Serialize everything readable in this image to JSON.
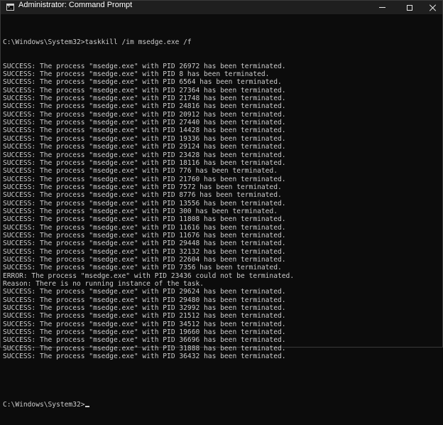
{
  "window": {
    "title": "Administrator: Command Prompt",
    "icon": "cmd-icon"
  },
  "terminal": {
    "command_line": "C:\\Windows\\System32>taskkill /im msedge.exe /f",
    "output_lines": [
      "SUCCESS: The process \"msedge.exe\" with PID 26972 has been terminated.",
      "SUCCESS: The process \"msedge.exe\" with PID 8 has been terminated.",
      "SUCCESS: The process \"msedge.exe\" with PID 6564 has been terminated.",
      "SUCCESS: The process \"msedge.exe\" with PID 27364 has been terminated.",
      "SUCCESS: The process \"msedge.exe\" with PID 21748 has been terminated.",
      "SUCCESS: The process \"msedge.exe\" with PID 24816 has been terminated.",
      "SUCCESS: The process \"msedge.exe\" with PID 20912 has been terminated.",
      "SUCCESS: The process \"msedge.exe\" with PID 27440 has been terminated.",
      "SUCCESS: The process \"msedge.exe\" with PID 14428 has been terminated.",
      "SUCCESS: The process \"msedge.exe\" with PID 19336 has been terminated.",
      "SUCCESS: The process \"msedge.exe\" with PID 29124 has been terminated.",
      "SUCCESS: The process \"msedge.exe\" with PID 23428 has been terminated.",
      "SUCCESS: The process \"msedge.exe\" with PID 18116 has been terminated.",
      "SUCCESS: The process \"msedge.exe\" with PID 776 has been terminated.",
      "SUCCESS: The process \"msedge.exe\" with PID 21760 has been terminated.",
      "SUCCESS: The process \"msedge.exe\" with PID 7572 has been terminated.",
      "SUCCESS: The process \"msedge.exe\" with PID 8776 has been terminated.",
      "SUCCESS: The process \"msedge.exe\" with PID 13556 has been terminated.",
      "SUCCESS: The process \"msedge.exe\" with PID 300 has been terminated.",
      "SUCCESS: The process \"msedge.exe\" with PID 11808 has been terminated.",
      "SUCCESS: The process \"msedge.exe\" with PID 11616 has been terminated.",
      "SUCCESS: The process \"msedge.exe\" with PID 11676 has been terminated.",
      "SUCCESS: The process \"msedge.exe\" with PID 29448 has been terminated.",
      "SUCCESS: The process \"msedge.exe\" with PID 32132 has been terminated.",
      "SUCCESS: The process \"msedge.exe\" with PID 22604 has been terminated.",
      "SUCCESS: The process \"msedge.exe\" with PID 7356 has been terminated.",
      "ERROR: The process \"msedge.exe\" with PID 23436 could not be terminated.",
      "Reason: There is no running instance of the task.",
      "SUCCESS: The process \"msedge.exe\" with PID 29624 has been terminated.",
      "SUCCESS: The process \"msedge.exe\" with PID 29480 has been terminated.",
      "SUCCESS: The process \"msedge.exe\" with PID 32992 has been terminated.",
      "SUCCESS: The process \"msedge.exe\" with PID 21512 has been terminated.",
      "SUCCESS: The process \"msedge.exe\" with PID 34512 has been terminated.",
      "SUCCESS: The process \"msedge.exe\" with PID 19660 has been terminated.",
      "SUCCESS: The process \"msedge.exe\" with PID 36696 has been terminated.",
      "SUCCESS: The process \"msedge.exe\" with PID 31888 has been terminated.",
      "SUCCESS: The process \"msedge.exe\" with PID 36432 has been terminated."
    ],
    "prompt": "C:\\Windows\\System32>"
  },
  "colors": {
    "background": "#0c0c0c",
    "titlebar": "#1f1f1f",
    "text": "#cccccc"
  }
}
